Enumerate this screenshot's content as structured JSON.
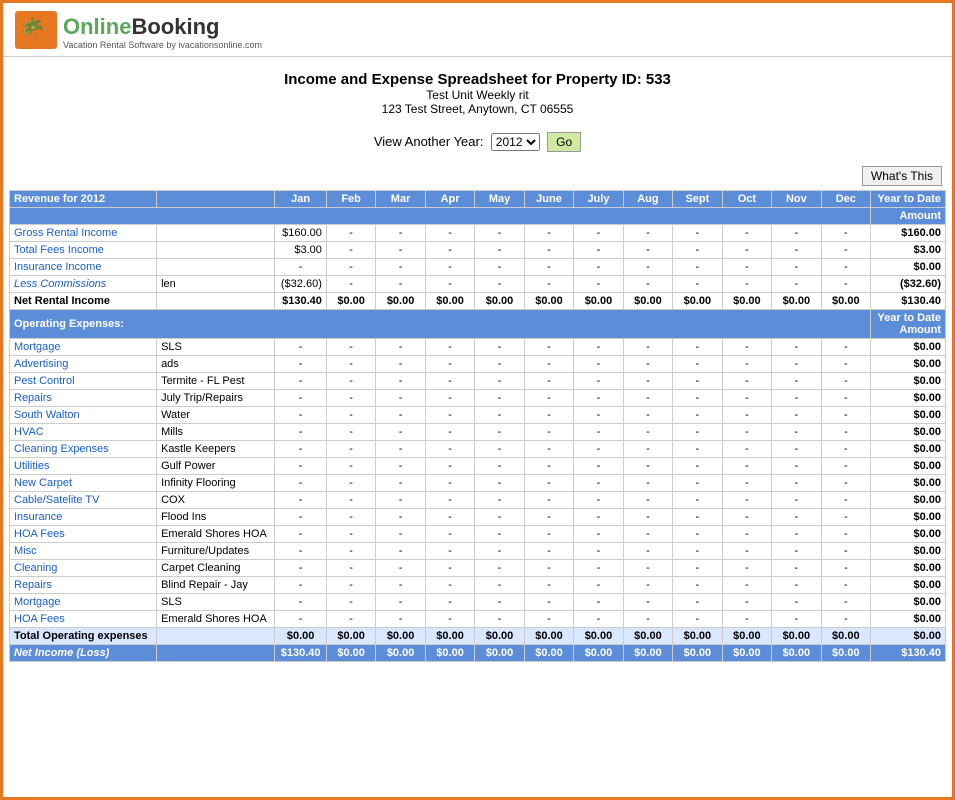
{
  "header": {
    "logo_text_online": "Online",
    "logo_text_booking": "Booking",
    "logo_sub": "Vacation Rental Software by ivacationsonline.com"
  },
  "title": {
    "main": "Income and Expense Spreadsheet for Property ID: 533",
    "sub1": "Test Unit Weekly rit",
    "sub2": "123 Test Street, Anytown, CT 06555"
  },
  "year_selector": {
    "label": "View Another Year:",
    "value": "2012",
    "button": "Go"
  },
  "whats_this": "What's This",
  "table": {
    "revenue_header": "Revenue for 2012",
    "months": [
      "Jan",
      "Feb",
      "Mar",
      "Apr",
      "May",
      "June",
      "July",
      "Aug",
      "Sept",
      "Oct",
      "Nov",
      "Dec"
    ],
    "ytd_label": "Year to Date",
    "amount_label": "Amount",
    "revenue_rows": [
      {
        "name": "Gross Rental Income",
        "vendor": "",
        "jan": "$160.00",
        "feb": "-",
        "mar": "-",
        "apr": "-",
        "may": "-",
        "june": "-",
        "july": "-",
        "aug": "-",
        "sept": "-",
        "oct": "-",
        "nov": "-",
        "dec": "-",
        "ytd": "$160.00"
      },
      {
        "name": "Total Fees Income",
        "vendor": "",
        "jan": "$3.00",
        "feb": "-",
        "mar": "-",
        "apr": "-",
        "may": "-",
        "june": "-",
        "july": "-",
        "aug": "-",
        "sept": "-",
        "oct": "-",
        "nov": "-",
        "dec": "-",
        "ytd": "$3.00"
      },
      {
        "name": "Insurance Income",
        "vendor": "",
        "jan": "-",
        "feb": "-",
        "mar": "-",
        "apr": "-",
        "may": "-",
        "june": "-",
        "july": "-",
        "aug": "-",
        "sept": "-",
        "oct": "-",
        "nov": "-",
        "dec": "-",
        "ytd": "$0.00"
      },
      {
        "name": "Less Commissions",
        "italic": true,
        "vendor": "len",
        "jan": "($32.60)",
        "feb": "-",
        "mar": "-",
        "apr": "-",
        "may": "-",
        "june": "-",
        "july": "-",
        "aug": "-",
        "sept": "-",
        "oct": "-",
        "nov": "-",
        "dec": "-",
        "ytd": "($32.60)"
      },
      {
        "name": "Net Rental Income",
        "bold": true,
        "vendor": "",
        "jan": "$130.40",
        "feb": "$0.00",
        "mar": "$0.00",
        "apr": "$0.00",
        "may": "$0.00",
        "june": "$0.00",
        "july": "$0.00",
        "aug": "$0.00",
        "sept": "$0.00",
        "oct": "$0.00",
        "nov": "$0.00",
        "dec": "$0.00",
        "ytd": "$130.40"
      }
    ],
    "operating_header": "Operating Expenses:",
    "operating_rows": [
      {
        "name": "Mortgage",
        "vendor": "SLS",
        "jan": "-",
        "feb": "-",
        "mar": "-",
        "apr": "-",
        "may": "-",
        "june": "-",
        "july": "-",
        "aug": "-",
        "sept": "-",
        "oct": "-",
        "nov": "-",
        "dec": "-",
        "ytd": "$0.00"
      },
      {
        "name": "Advertising",
        "vendor": "ads",
        "jan": "-",
        "feb": "-",
        "mar": "-",
        "apr": "-",
        "may": "-",
        "june": "-",
        "july": "-",
        "aug": "-",
        "sept": "-",
        "oct": "-",
        "nov": "-",
        "dec": "-",
        "ytd": "$0.00"
      },
      {
        "name": "Pest Control",
        "vendor": "Termite - FL Pest",
        "jan": "-",
        "feb": "-",
        "mar": "-",
        "apr": "-",
        "may": "-",
        "june": "-",
        "july": "-",
        "aug": "-",
        "sept": "-",
        "oct": "-",
        "nov": "-",
        "dec": "-",
        "ytd": "$0.00"
      },
      {
        "name": "Repairs",
        "vendor": "July Trip/Repairs",
        "jan": "-",
        "feb": "-",
        "mar": "-",
        "apr": "-",
        "may": "-",
        "june": "-",
        "july": "-",
        "aug": "-",
        "sept": "-",
        "oct": "-",
        "nov": "-",
        "dec": "-",
        "ytd": "$0.00"
      },
      {
        "name": "South Walton",
        "vendor": "Water",
        "jan": "-",
        "feb": "-",
        "mar": "-",
        "apr": "-",
        "may": "-",
        "june": "-",
        "july": "-",
        "aug": "-",
        "sept": "-",
        "oct": "-",
        "nov": "-",
        "dec": "-",
        "ytd": "$0.00"
      },
      {
        "name": "HVAC",
        "vendor": "Mills",
        "jan": "-",
        "feb": "-",
        "mar": "-",
        "apr": "-",
        "may": "-",
        "june": "-",
        "july": "-",
        "aug": "-",
        "sept": "-",
        "oct": "-",
        "nov": "-",
        "dec": "-",
        "ytd": "$0.00"
      },
      {
        "name": "Cleaning Expenses",
        "vendor": "Kastle Keepers",
        "jan": "-",
        "feb": "-",
        "mar": "-",
        "apr": "-",
        "may": "-",
        "june": "-",
        "july": "-",
        "aug": "-",
        "sept": "-",
        "oct": "-",
        "nov": "-",
        "dec": "-",
        "ytd": "$0.00"
      },
      {
        "name": "Utilities",
        "vendor": "Gulf Power",
        "jan": "-",
        "feb": "-",
        "mar": "-",
        "apr": "-",
        "may": "-",
        "june": "-",
        "july": "-",
        "aug": "-",
        "sept": "-",
        "oct": "-",
        "nov": "-",
        "dec": "-",
        "ytd": "$0.00"
      },
      {
        "name": "New Carpet",
        "vendor": "Infinity Flooring",
        "jan": "-",
        "feb": "-",
        "mar": "-",
        "apr": "-",
        "may": "-",
        "june": "-",
        "july": "-",
        "aug": "-",
        "sept": "-",
        "oct": "-",
        "nov": "-",
        "dec": "-",
        "ytd": "$0.00"
      },
      {
        "name": "Cable/Satelite TV",
        "vendor": "COX",
        "jan": "-",
        "feb": "-",
        "mar": "-",
        "apr": "-",
        "may": "-",
        "june": "-",
        "july": "-",
        "aug": "-",
        "sept": "-",
        "oct": "-",
        "nov": "-",
        "dec": "-",
        "ytd": "$0.00"
      },
      {
        "name": "Insurance",
        "vendor": "Flood Ins",
        "jan": "-",
        "feb": "-",
        "mar": "-",
        "apr": "-",
        "may": "-",
        "june": "-",
        "july": "-",
        "aug": "-",
        "sept": "-",
        "oct": "-",
        "nov": "-",
        "dec": "-",
        "ytd": "$0.00"
      },
      {
        "name": "HOA Fees",
        "vendor": "Emerald Shores HOA",
        "jan": "-",
        "feb": "-",
        "mar": "-",
        "apr": "-",
        "may": "-",
        "june": "-",
        "july": "-",
        "aug": "-",
        "sept": "-",
        "oct": "-",
        "nov": "-",
        "dec": "-",
        "ytd": "$0.00"
      },
      {
        "name": "Misc",
        "vendor": "Furniture/Updates",
        "jan": "-",
        "feb": "-",
        "mar": "-",
        "apr": "-",
        "may": "-",
        "june": "-",
        "july": "-",
        "aug": "-",
        "sept": "-",
        "oct": "-",
        "nov": "-",
        "dec": "-",
        "ytd": "$0.00"
      },
      {
        "name": "Cleaning",
        "vendor": "Carpet Cleaning",
        "jan": "-",
        "feb": "-",
        "mar": "-",
        "apr": "-",
        "may": "-",
        "june": "-",
        "july": "-",
        "aug": "-",
        "sept": "-",
        "oct": "-",
        "nov": "-",
        "dec": "-",
        "ytd": "$0.00"
      },
      {
        "name": "Repairs",
        "vendor": "Blind Repair - Jay",
        "jan": "-",
        "feb": "-",
        "mar": "-",
        "apr": "-",
        "may": "-",
        "june": "-",
        "july": "-",
        "aug": "-",
        "sept": "-",
        "oct": "-",
        "nov": "-",
        "dec": "-",
        "ytd": "$0.00"
      },
      {
        "name": "Mortgage",
        "vendor": "SLS",
        "jan": "-",
        "feb": "-",
        "mar": "-",
        "apr": "-",
        "may": "-",
        "june": "-",
        "july": "-",
        "aug": "-",
        "sept": "-",
        "oct": "-",
        "nov": "-",
        "dec": "-",
        "ytd": "$0.00"
      },
      {
        "name": "HOA Fees",
        "vendor": "Emerald Shores HOA",
        "jan": "-",
        "feb": "-",
        "mar": "-",
        "apr": "-",
        "may": "-",
        "june": "-",
        "july": "-",
        "aug": "-",
        "sept": "-",
        "oct": "-",
        "nov": "-",
        "dec": "-",
        "ytd": "$0.00"
      }
    ],
    "total_operating": {
      "label": "Total Operating expenses",
      "jan": "$0.00",
      "feb": "$0.00",
      "mar": "$0.00",
      "apr": "$0.00",
      "may": "$0.00",
      "june": "$0.00",
      "july": "$0.00",
      "aug": "$0.00",
      "sept": "$0.00",
      "oct": "$0.00",
      "nov": "$0.00",
      "dec": "$0.00",
      "ytd": "$0.00"
    },
    "net_income": {
      "label": "Net Income (Loss)",
      "jan": "$130.40",
      "feb": "$0.00",
      "mar": "$0.00",
      "apr": "$0.00",
      "may": "$0.00",
      "june": "$0.00",
      "july": "$0.00",
      "aug": "$0.00",
      "sept": "$0.00",
      "oct": "$0.00",
      "nov": "$0.00",
      "dec": "$0.00",
      "ytd": "$130.40"
    }
  }
}
